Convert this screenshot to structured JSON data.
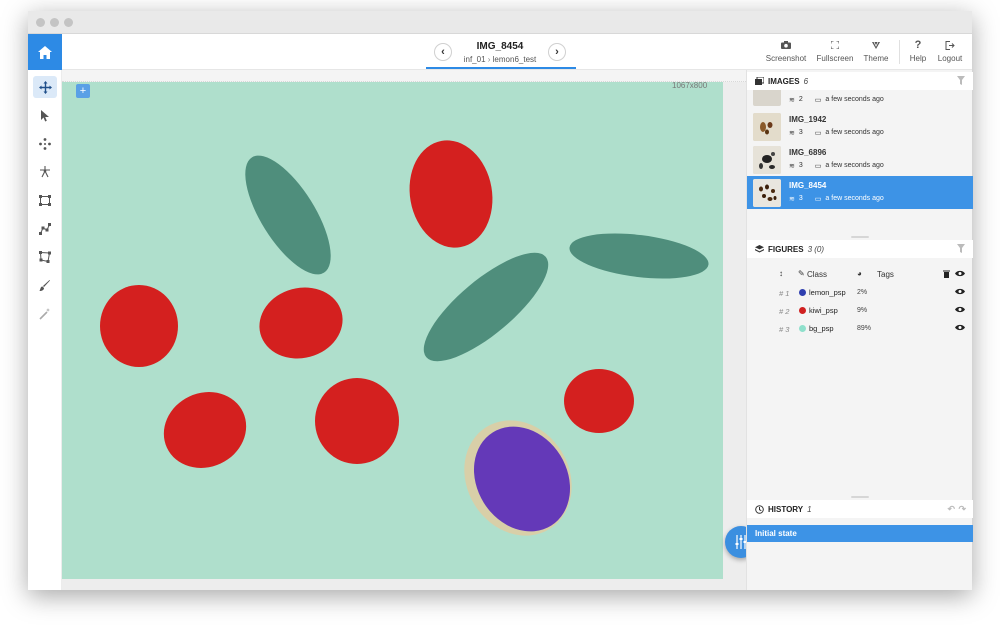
{
  "image": {
    "title": "IMG_8454",
    "breadcrumb_project": "inf_01",
    "breadcrumb_dataset": "lemon6_test",
    "dimensions": "1067x800"
  },
  "toolbar": {
    "screenshot": "Screenshot",
    "fullscreen": "Fullscreen",
    "theme": "Theme",
    "help": "Help",
    "logout": "Logout"
  },
  "images_panel": {
    "title": "IMAGES",
    "count": "6",
    "items": [
      {
        "name": "",
        "figures": "2",
        "time": "a few seconds ago"
      },
      {
        "name": "IMG_1942",
        "figures": "3",
        "time": "a few seconds ago"
      },
      {
        "name": "IMG_6896",
        "figures": "3",
        "time": "a few seconds ago"
      },
      {
        "name": "IMG_8454",
        "figures": "3",
        "time": "a few seconds ago"
      }
    ]
  },
  "figures_panel": {
    "title": "FIGURES",
    "count": "3 (0)",
    "col_class": "Class",
    "col_tags": "Tags",
    "items": [
      {
        "num": "# 1",
        "class": "lemon_psp",
        "pct": "2%",
        "color": "#2f3fb0"
      },
      {
        "num": "# 2",
        "class": "kiwi_psp",
        "pct": "9%",
        "color": "#d02020"
      },
      {
        "num": "# 3",
        "class": "bg_psp",
        "pct": "89%",
        "color": "#8fe0cc"
      }
    ]
  },
  "history_panel": {
    "title": "HISTORY",
    "count": "1",
    "items": [
      "Initial state"
    ]
  }
}
